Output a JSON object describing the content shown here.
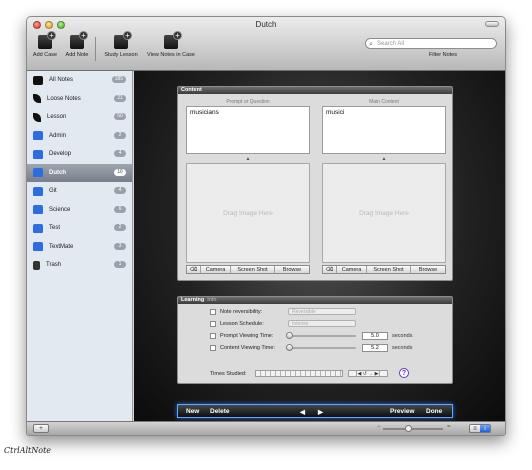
{
  "window": {
    "title": "Dutch"
  },
  "toolbar": {
    "add_case": "Add Case",
    "add_note": "Add Note",
    "study_lesson": "Study Lesson",
    "view_notes_in_case": "View Notes in Case",
    "search_placeholder": "Search All",
    "filter_notes": "Filter Notes"
  },
  "sidebar": {
    "items": [
      {
        "label": "All Notes",
        "count": "185",
        "icon": "notes-icon"
      },
      {
        "label": "Loose Notes",
        "count": "21",
        "icon": "leaf-icon"
      },
      {
        "label": "Lesson",
        "count": "50",
        "icon": "leaf-icon"
      },
      {
        "label": "Admin",
        "count": "2",
        "icon": "folder-icon"
      },
      {
        "label": "Develop",
        "count": "4",
        "icon": "folder-icon"
      },
      {
        "label": "Dutch",
        "count": "10",
        "icon": "folder-icon"
      },
      {
        "label": "Git",
        "count": "4",
        "icon": "folder-icon"
      },
      {
        "label": "Science",
        "count": "6",
        "icon": "folder-icon"
      },
      {
        "label": "Test",
        "count": "2",
        "icon": "folder-icon"
      },
      {
        "label": "TextMate",
        "count": "3",
        "icon": "folder-icon"
      },
      {
        "label": "Trash",
        "count": "1",
        "icon": "trash-icon"
      }
    ],
    "selected_index": 5
  },
  "content": {
    "header": "Content",
    "prompt_label": "Prompt or Question",
    "main_label": "Main Content",
    "prompt_value": "musicians",
    "main_value": "musici",
    "drag_image": "Drag Image Here",
    "buttons": {
      "clear": "⌫",
      "camera": "Camera",
      "screen_shot": "Screen Shot",
      "browse": "Browse"
    }
  },
  "learning": {
    "header": "Learning",
    "tab2": "Info",
    "note_reversibility": "Note reversibility:",
    "reversibility_value": "Reversible",
    "lesson_schedule": "Lesson Schedule:",
    "schedule_value": "Intense",
    "prompt_viewing": "Prompt Viewing Time:",
    "prompt_viewing_value": "5.0",
    "content_viewing": "Content Viewing Time:",
    "content_viewing_value": "5.2",
    "seconds": "seconds",
    "times_studied": "Times Studied:",
    "studied_nav": "|◀ ↺ → ▶|",
    "help": "?"
  },
  "bottombar": {
    "new": "New",
    "delete": "Delete",
    "prev": "◀",
    "next": "▶",
    "preview": "Preview",
    "done": "Done"
  },
  "statusbar": {
    "add": "+",
    "list_icon": "≡",
    "info_icon": "i"
  },
  "watermark": "CtrlAltNote"
}
